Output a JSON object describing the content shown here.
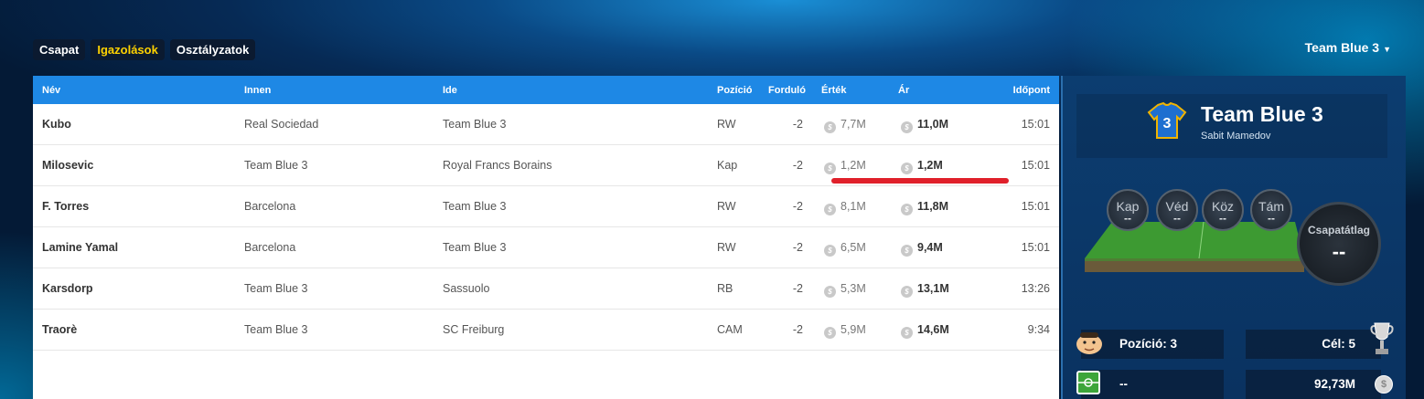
{
  "tabs": [
    {
      "label": "Csapat",
      "active": false
    },
    {
      "label": "Igazolások",
      "active": true
    },
    {
      "label": "Osztályzatok",
      "active": false
    }
  ],
  "team_selector": {
    "label": "Team Blue 3"
  },
  "table": {
    "headers": {
      "name": "Név",
      "from": "Innen",
      "to": "Ide",
      "position": "Pozíció",
      "round": "Forduló",
      "value": "Érték",
      "price": "Ár",
      "time": "Időpont"
    },
    "rows": [
      {
        "name": "Kubo",
        "from": "Real Sociedad",
        "to": "Team Blue 3",
        "position": "RW",
        "round": "-2",
        "value": "7,7M",
        "price": "11,0M",
        "time": "15:01"
      },
      {
        "name": "Milosevic",
        "from": "Team Blue 3",
        "to": "Royal Francs Borains",
        "position": "Kap",
        "round": "-2",
        "value": "1,2M",
        "price": "1,2M",
        "time": "15:01"
      },
      {
        "name": "F. Torres",
        "from": "Barcelona",
        "to": "Team Blue 3",
        "position": "RW",
        "round": "-2",
        "value": "8,1M",
        "price": "11,8M",
        "time": "15:01"
      },
      {
        "name": "Lamine Yamal",
        "from": "Barcelona",
        "to": "Team Blue 3",
        "position": "RW",
        "round": "-2",
        "value": "6,5M",
        "price": "9,4M",
        "time": "15:01"
      },
      {
        "name": "Karsdorp",
        "from": "Team Blue 3",
        "to": "Sassuolo",
        "position": "RB",
        "round": "-2",
        "value": "5,3M",
        "price": "13,1M",
        "time": "13:26"
      },
      {
        "name": "Traorè",
        "from": "Team Blue 3",
        "to": "SC Freiburg",
        "position": "CAM",
        "round": "-2",
        "value": "5,9M",
        "price": "14,6M",
        "time": "9:34"
      }
    ]
  },
  "panel": {
    "jersey_number": "3",
    "team_name": "Team Blue 3",
    "manager": "Sabit Mamedov",
    "lines": [
      {
        "label": "Kap",
        "value": "--"
      },
      {
        "label": "Véd",
        "value": "--"
      },
      {
        "label": "Köz",
        "value": "--"
      },
      {
        "label": "Tám",
        "value": "--"
      }
    ],
    "average": {
      "label": "Csapatátlag",
      "value": "--"
    },
    "position_stat": "Pozíció: 3",
    "goal_stat": "Cél: 5",
    "formation": "--",
    "budget": "92,73M"
  },
  "colors": {
    "header_blue": "#1e88e5",
    "active_tab": "#ffd200",
    "highlight": "#e0202a"
  }
}
